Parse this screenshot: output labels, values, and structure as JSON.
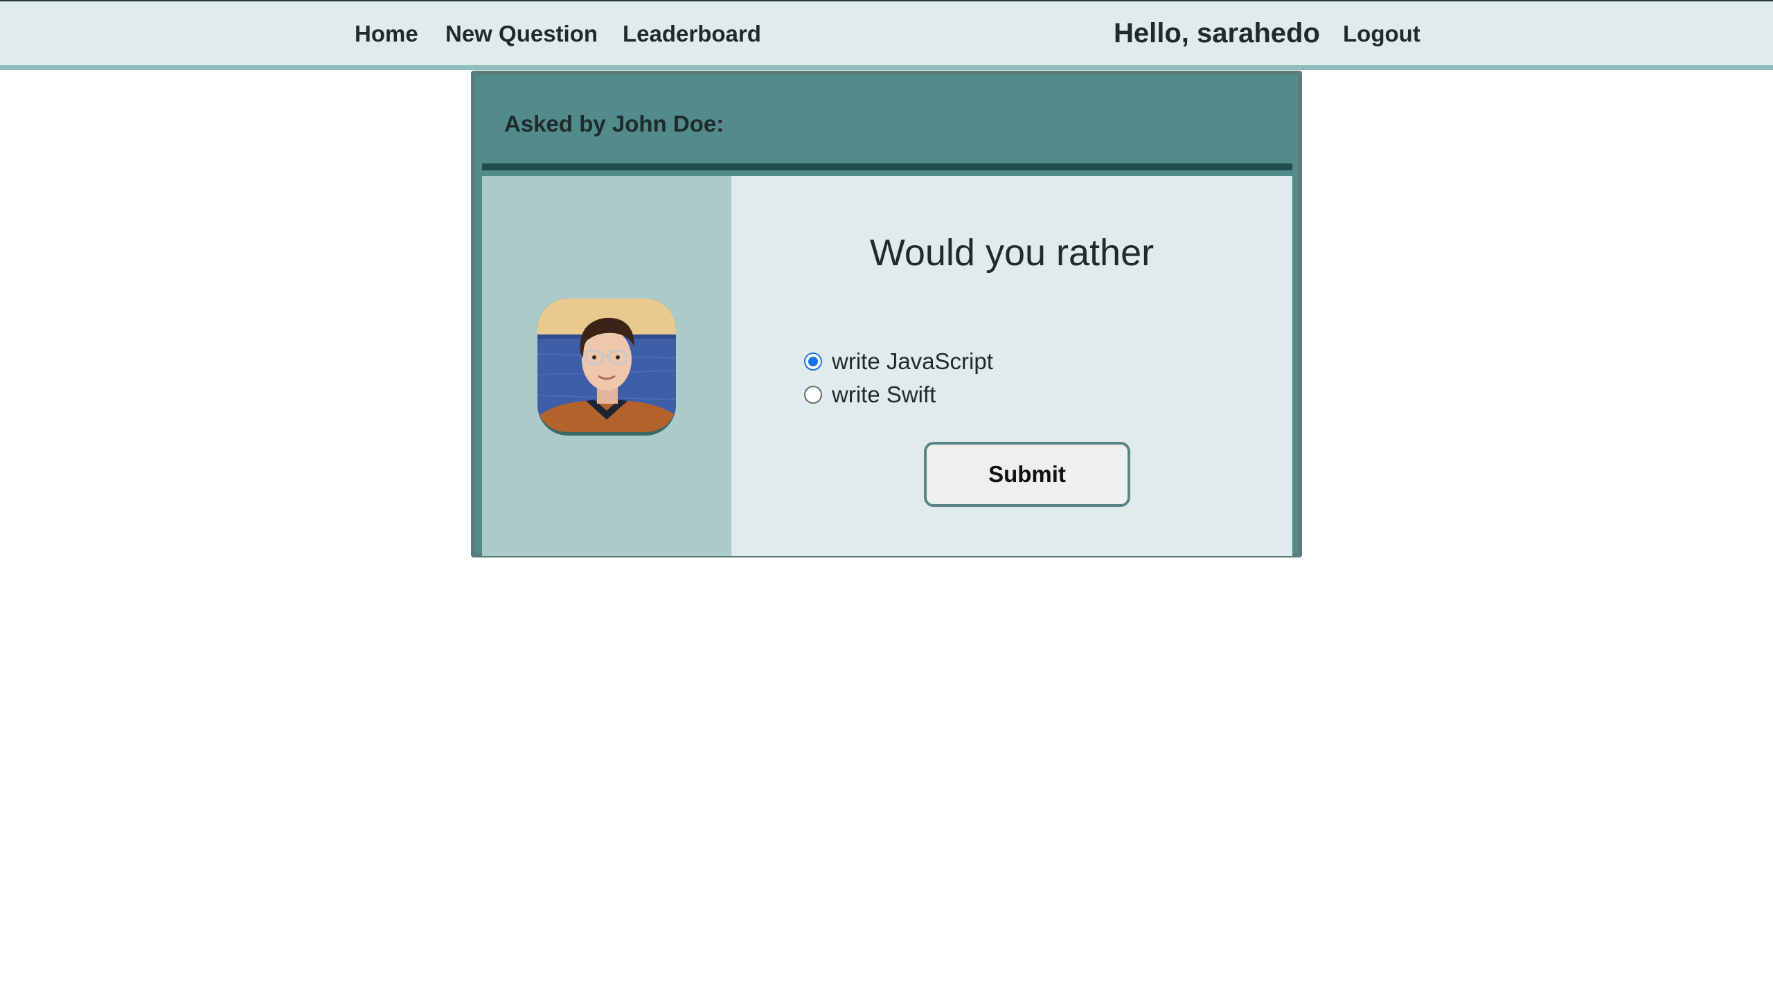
{
  "nav": {
    "home": "Home",
    "new_question": "New Question",
    "leaderboard": "Leaderboard",
    "greeting": "Hello, sarahedo",
    "logout": "Logout"
  },
  "poll": {
    "asked_by": "Asked by John Doe:",
    "title": "Would you rather",
    "options": [
      {
        "label": "write JavaScript",
        "selected": true
      },
      {
        "label": "write Swift",
        "selected": false
      }
    ],
    "submit_label": "Submit"
  },
  "colors": {
    "nav_bg": "#e0ebeb",
    "card_header": "#528b89",
    "avatar_panel": "#abcbcb",
    "question_panel": "#e0ebeb",
    "radio_accent": "#1a73e8"
  }
}
